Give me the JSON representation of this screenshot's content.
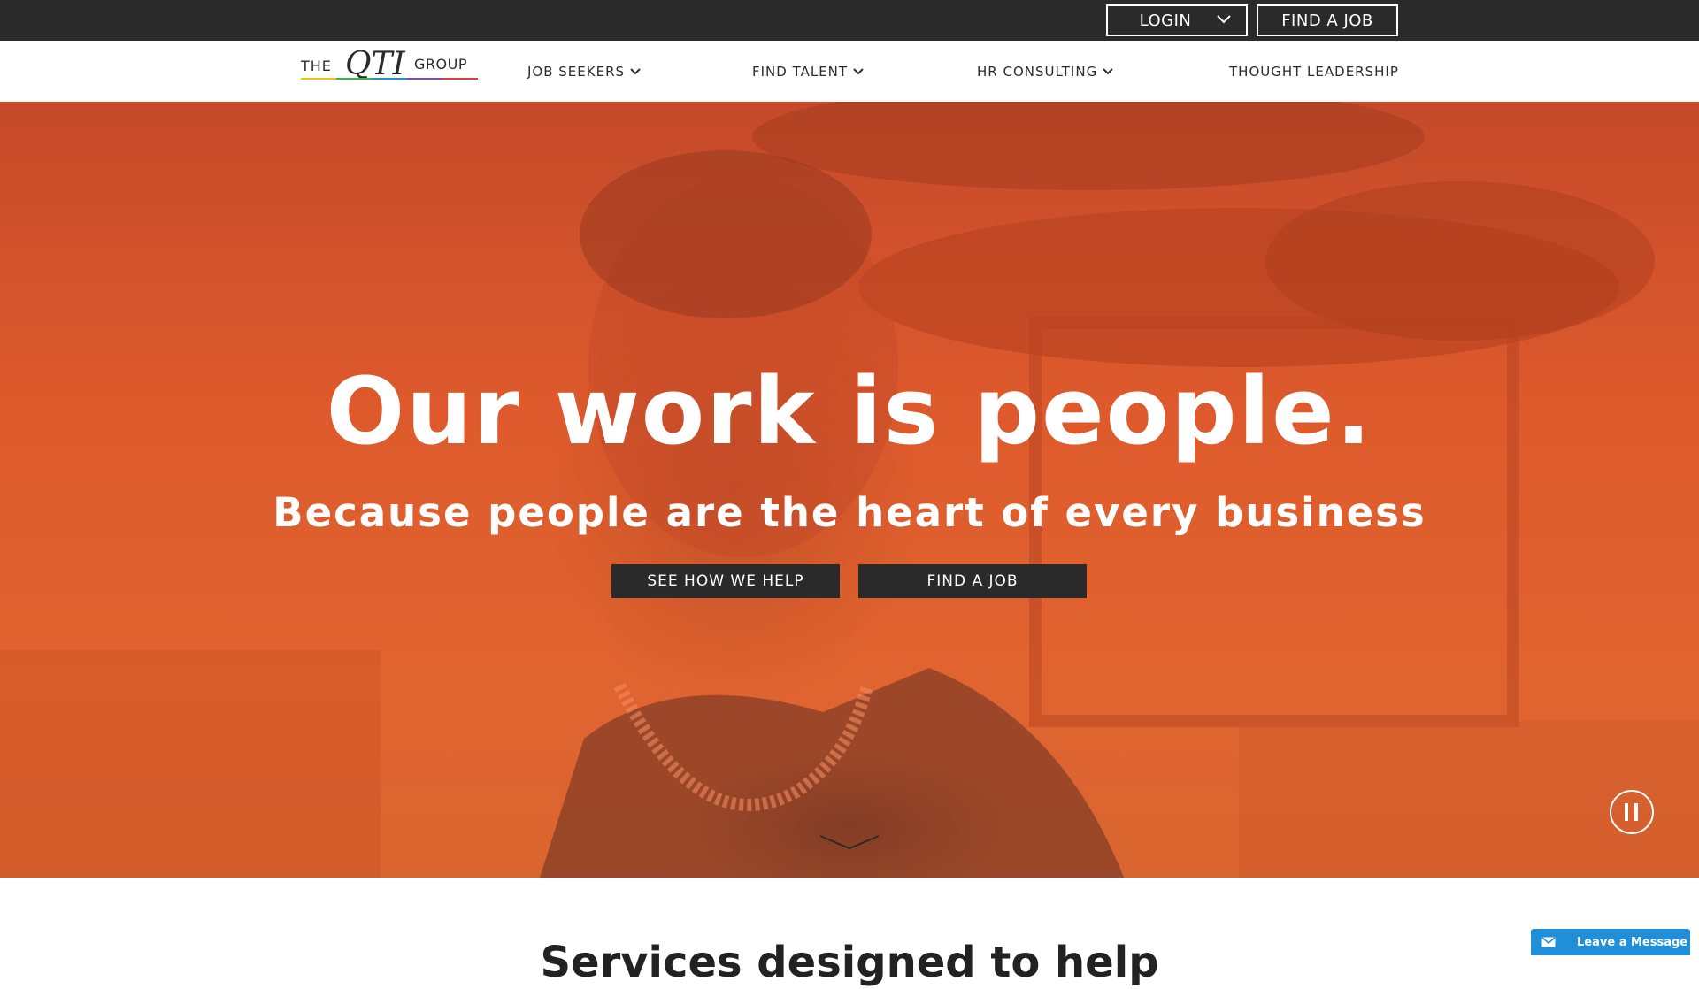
{
  "utility_bar": {
    "login_label": "LOGIN",
    "find_job_label": "FIND A JOB"
  },
  "logo": {
    "text_the": "THE",
    "text_qti": "QTI",
    "text_group": "GROUP"
  },
  "nav": {
    "items": [
      {
        "label": "JOB SEEKERS",
        "has_dropdown": true
      },
      {
        "label": "FIND TALENT",
        "has_dropdown": true
      },
      {
        "label": "HR CONSULTING",
        "has_dropdown": true
      },
      {
        "label": "THOUGHT LEADERSHIP",
        "has_dropdown": false
      }
    ]
  },
  "hero": {
    "title": "Our work is people.",
    "subtitle": "Because people are the heart of every business",
    "buttons": {
      "help_label": "SEE HOW WE HELP",
      "find_job_label": "FIND A JOB"
    },
    "overlay_color": "#e0592c"
  },
  "section": {
    "title": "Services designed to help"
  },
  "chat": {
    "label": "Leave a Message",
    "color": "#1f8fd9"
  },
  "icons": [
    "chevron-down-icon",
    "pause-icon",
    "mail-icon",
    "scroll-down-icon"
  ]
}
